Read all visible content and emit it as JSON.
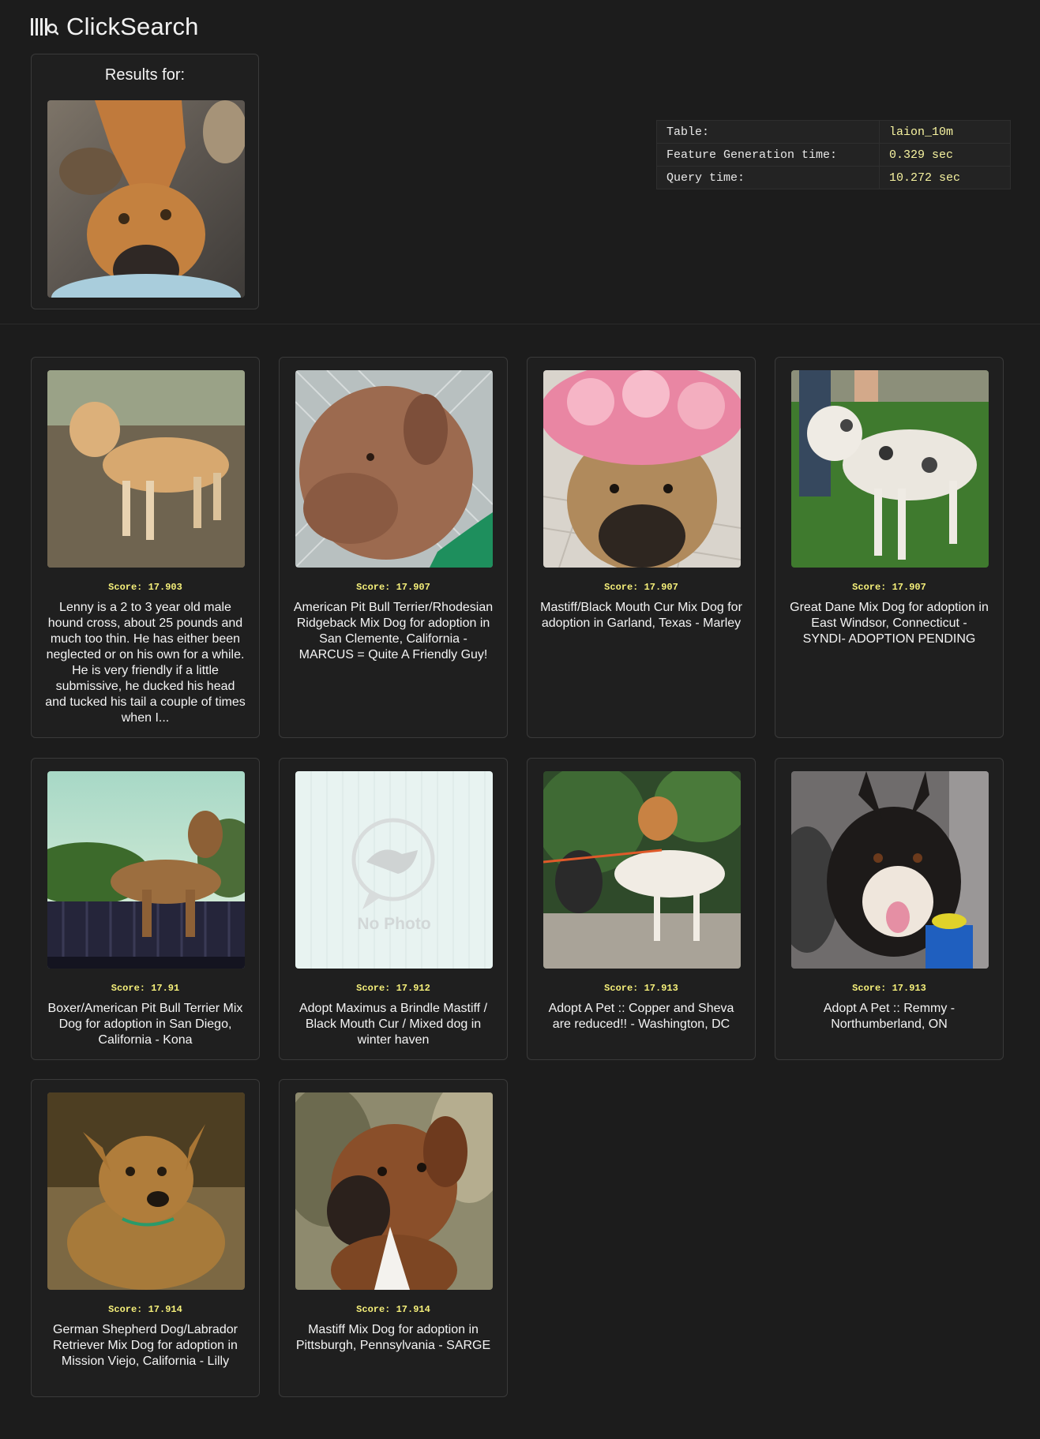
{
  "app": {
    "name": "ClickSearch"
  },
  "query": {
    "heading": "Results for:"
  },
  "stats": [
    {
      "key": "Table:",
      "value": "laion_10m"
    },
    {
      "key": "Feature Generation time:",
      "value": "0.329 sec"
    },
    {
      "key": "Query time:",
      "value": "10.272 sec"
    }
  ],
  "score_label": "Score: ",
  "results": [
    {
      "score": "17.903",
      "caption": "Lenny is a 2 to 3 year old male hound cross, about 25 pounds and much too thin. He has either been neglected or on his own for a while. He is very friendly if a little submissive, he ducked his head and tucked his tail a couple of times when I..."
    },
    {
      "score": "17.907",
      "caption": "American Pit Bull Terrier/Rhodesian Ridgeback Mix Dog for adoption in San Clemente, California - MARCUS = Quite A Friendly Guy!"
    },
    {
      "score": "17.907",
      "caption": "Mastiff/Black Mouth Cur Mix Dog for adoption in Garland, Texas - Marley"
    },
    {
      "score": "17.907",
      "caption": "Great Dane Mix Dog for adoption in East Windsor, Connecticut - SYNDI- ADOPTION PENDING"
    },
    {
      "score": "17.91",
      "caption": "Boxer/American Pit Bull Terrier Mix Dog for adoption in San Diego, California - Kona"
    },
    {
      "score": "17.912",
      "caption": "Adopt Maximus a Brindle Mastiff / Black Mouth Cur / Mixed dog in winter haven",
      "no_photo_text": "No Photo"
    },
    {
      "score": "17.913",
      "caption": "Adopt A Pet :: Copper and Sheva are reduced!! - Washington, DC"
    },
    {
      "score": "17.913",
      "caption": "Adopt A Pet :: Remmy - Northumberland, ON"
    },
    {
      "score": "17.914",
      "caption": "German Shepherd Dog/Labrador Retriever Mix Dog for adoption in Mission Viejo, California - Lilly"
    },
    {
      "score": "17.914",
      "caption": "Mastiff Mix Dog for adoption in Pittsburgh, Pennsylvania - SARGE"
    }
  ]
}
